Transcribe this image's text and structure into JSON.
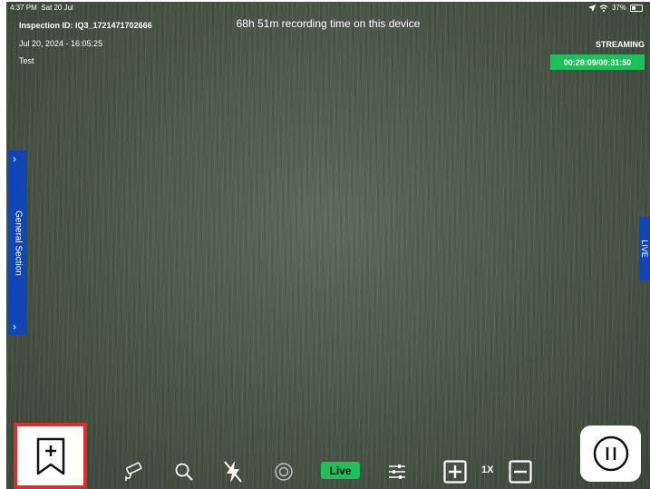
{
  "status_bar": {
    "time": "4:37 PM",
    "date": "Sat 20 Jul",
    "battery": "37%"
  },
  "recording_info": {
    "inspection_id": "Inspection ID: IQ3_1721471702666",
    "datetime": "Jul 20, 2024 - 16:05:25",
    "label": "Test",
    "recording_time": "68h 51m recording time on this device"
  },
  "streaming": {
    "label": "STREAMING",
    "timer": "00:28:09/00:31:50"
  },
  "side_panels": {
    "left_label": "General Section",
    "right_label": "LIVE"
  },
  "toolbar": {
    "live_label": "Live",
    "zoom_level": "1X"
  },
  "colors": {
    "accent_blue": "#1346b4",
    "live_green": "#1fbf5a",
    "highlight_red": "#e12a2a"
  }
}
